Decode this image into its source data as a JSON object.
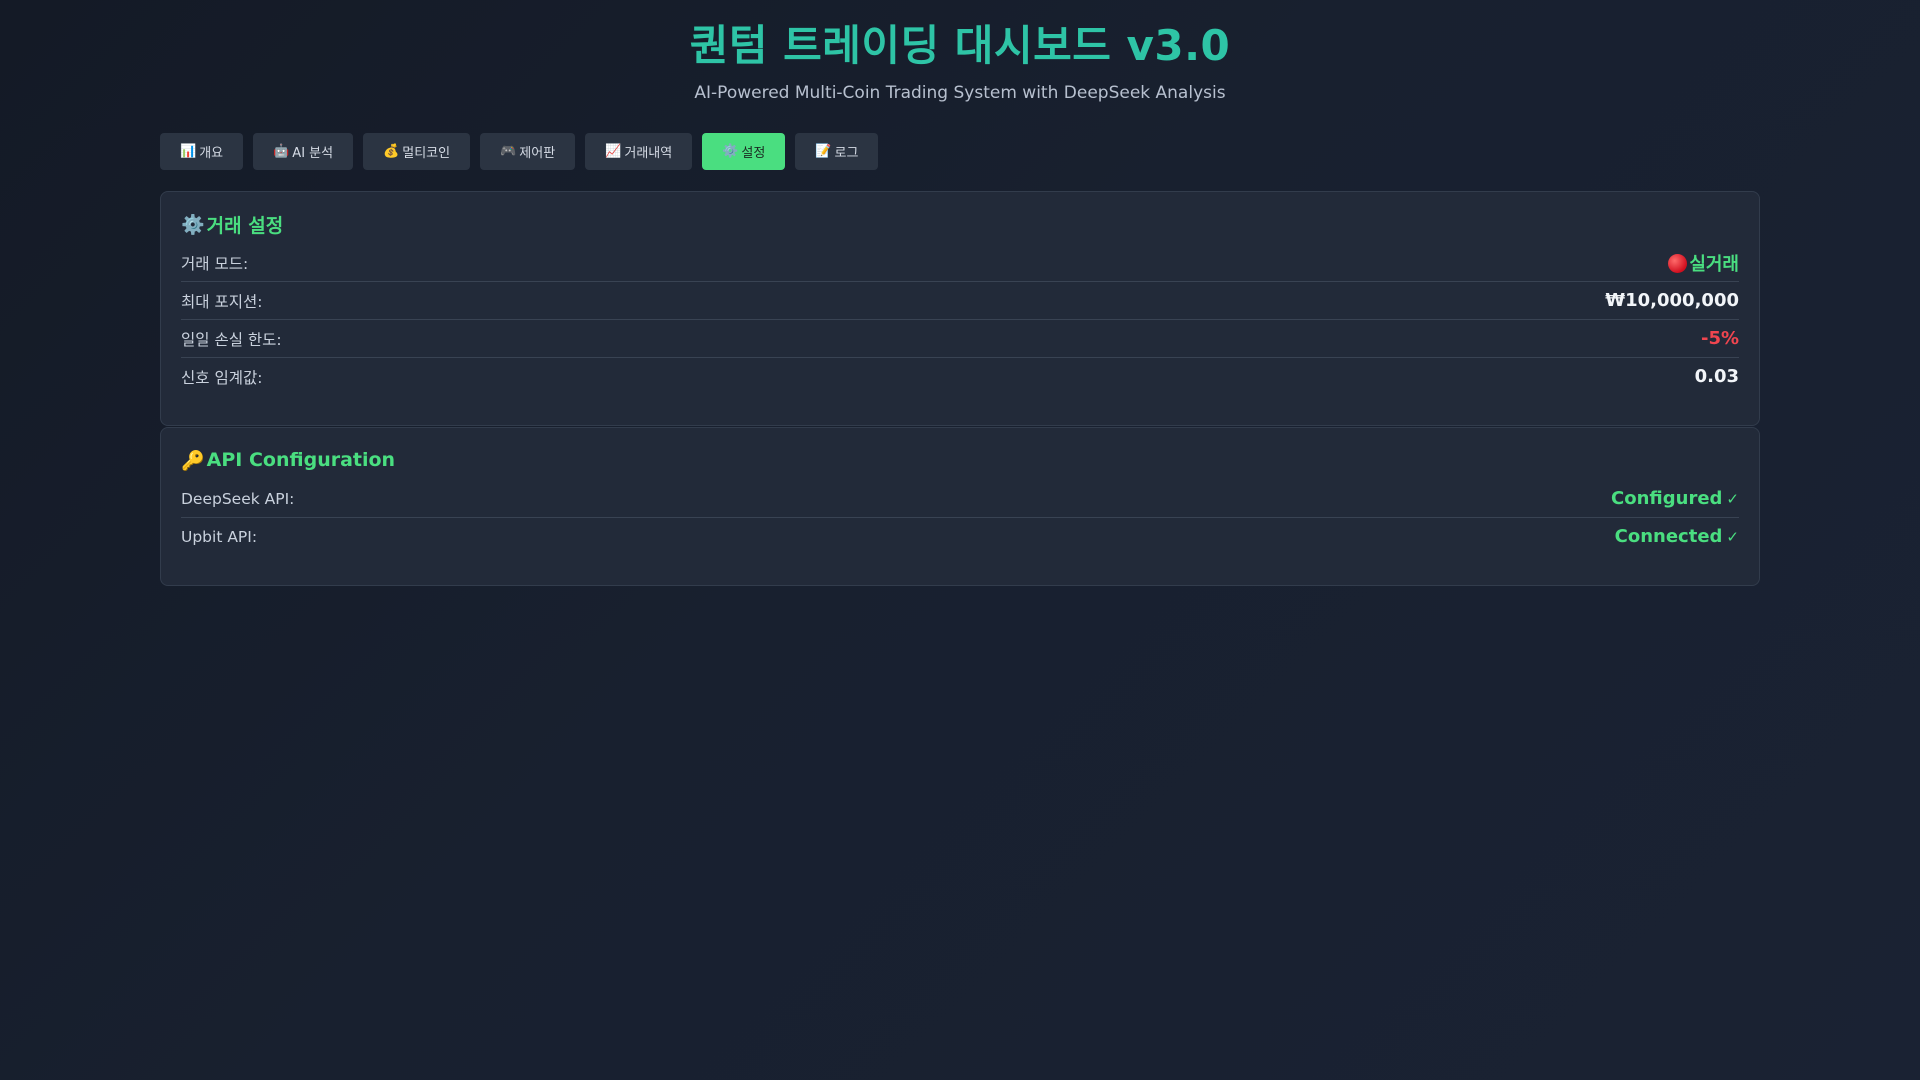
{
  "header": {
    "title": "퀀텀 트레이딩 대시보드 v3.0",
    "subtitle": "AI-Powered Multi-Coin Trading System with DeepSeek Analysis"
  },
  "tabs": [
    {
      "icon": "📊",
      "label": "개요",
      "active": false
    },
    {
      "icon": "🤖",
      "label": "AI 분석",
      "active": false
    },
    {
      "icon": "💰",
      "label": "멀티코인",
      "active": false
    },
    {
      "icon": "🎮",
      "label": "제어판",
      "active": false
    },
    {
      "icon": "📈",
      "label": "거래내역",
      "active": false
    },
    {
      "icon": "⚙️",
      "label": "설정",
      "active": true
    },
    {
      "icon": "📝",
      "label": "로그",
      "active": false
    }
  ],
  "trade_settings": {
    "icon": "⚙️",
    "title": "거래 설정",
    "rows": [
      {
        "label": "거래 모드:",
        "value": "실거래"
      },
      {
        "label": "최대 포지션:",
        "value": "₩10,000,000"
      },
      {
        "label": "일일 손실 한도:",
        "value": "-5%"
      },
      {
        "label": "신호 임계값:",
        "value": "0.03"
      }
    ]
  },
  "api_config": {
    "icon": "🔑",
    "title": "API Configuration",
    "rows": [
      {
        "label": "DeepSeek API:",
        "value": "Configured",
        "check": "✓"
      },
      {
        "label": "Upbit API:",
        "value": "Connected",
        "check": "✓"
      }
    ]
  },
  "colors": {
    "accent_teal": "#2ec4a6",
    "accent_green": "#4ade80",
    "danger_red": "#f0454f",
    "background": "#18202f",
    "panel": "#222a39"
  }
}
